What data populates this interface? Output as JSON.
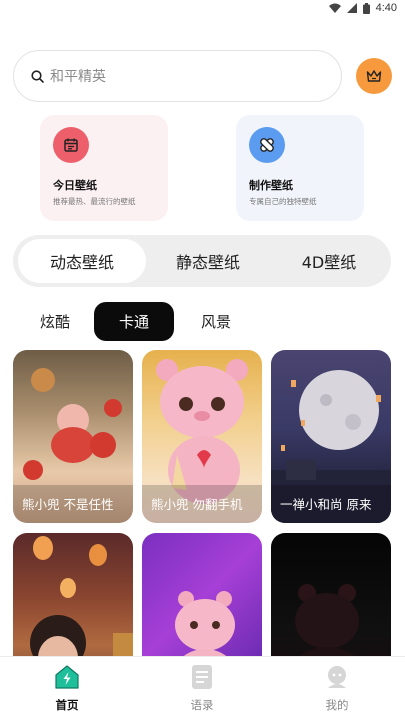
{
  "status_bar": {
    "time": "4:40",
    "icons": [
      "wifi-icon",
      "signal-icon",
      "battery-icon"
    ]
  },
  "search": {
    "placeholder": "和平精英",
    "icon": "search-icon"
  },
  "crown_button": {
    "icon": "crown-icon",
    "color": "#f79a3e"
  },
  "feature_cards": [
    {
      "title": "今日壁纸",
      "desc": "推荐最热、最流行的壁纸",
      "icon": "calendar-icon",
      "color": "#ec5f6b"
    },
    {
      "title": "制作壁纸",
      "desc": "专属自己的独特壁纸",
      "icon": "bandage-icon",
      "color": "#5b9cf0"
    }
  ],
  "type_tabs": [
    {
      "label": "动态壁纸",
      "active": true
    },
    {
      "label": "静态壁纸",
      "active": false
    },
    {
      "label": "4D壁纸",
      "active": false
    }
  ],
  "categories": [
    {
      "label": "炫酷",
      "active": false
    },
    {
      "label": "卡通",
      "active": true
    },
    {
      "label": "风景",
      "active": false
    }
  ],
  "wallpapers": [
    {
      "caption": "熊小兜 不是任性"
    },
    {
      "caption": "熊小兜 勿翻手机"
    },
    {
      "caption": "一禅小和尚 原来"
    },
    {
      "caption": ""
    },
    {
      "caption": ""
    },
    {
      "caption": ""
    }
  ],
  "bottom_nav": [
    {
      "label": "首页",
      "icon": "home-icon",
      "active": true
    },
    {
      "label": "语录",
      "icon": "notes-icon",
      "active": false
    },
    {
      "label": "我的",
      "icon": "profile-icon",
      "active": false
    }
  ],
  "colors": {
    "accent": "#1fbf9b",
    "crown": "#f79a3e",
    "active_category": "#0b0b0b"
  }
}
